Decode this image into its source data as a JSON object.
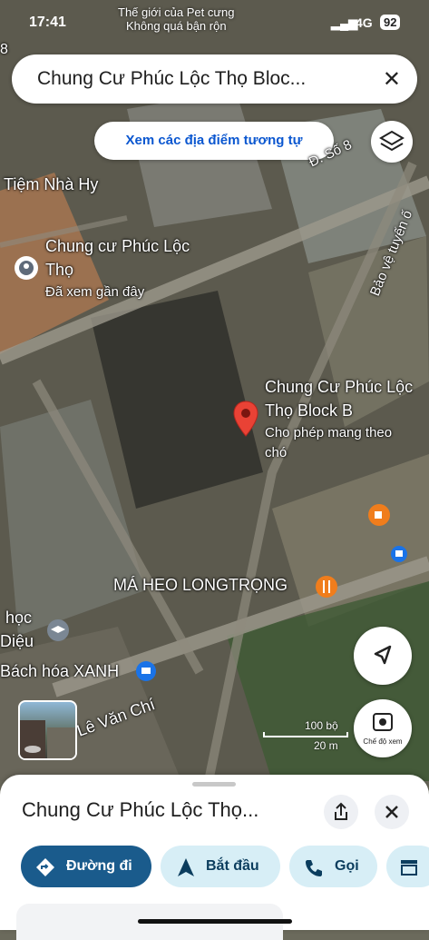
{
  "status": {
    "time": "17:41",
    "network": "4G",
    "battery": "92",
    "top_line1": "Thế giới của Pet cưng",
    "top_line2": "Không quá bận rộn"
  },
  "search": {
    "query": "Chung Cư Phúc Lộc Thọ Bloc...",
    "close_icon": "close-icon"
  },
  "similar_button": "Xem các địa điểm tương tự",
  "map_labels": {
    "tiem": "Tiệm Nhà Hy",
    "chungcu_line1": "Chung cư Phúc Lộc",
    "chungcu_line2": "Thọ",
    "chungcu_sub": "Đã xem gần đây",
    "block_line1": "Chung Cư Phúc Lộc",
    "block_line2": "Thọ Block B",
    "block_sub1": "Cho phép mang theo",
    "block_sub2": "chó",
    "mheo": "MÁ HEO LONGTRỌNG",
    "hoc": "học",
    "dieu": "Diệu",
    "bhx": "Bách hóa XANH",
    "levanchi": "Lê Văn Chí",
    "duongso8": "Đ. Số 8",
    "baove": "Bảo vệ tuyến ố",
    "num8": "8"
  },
  "scale": {
    "feet": "100 bộ",
    "meters": "20 m"
  },
  "street_view_caption": "Chế độ xem",
  "place": {
    "title": "Chung Cư Phúc Lộc Thọ...",
    "actions": [
      "Đường đi",
      "Bắt đầu",
      "Gọi"
    ]
  },
  "colors": {
    "accent": "#1a5b8c",
    "chip_bg": "#d7eef6",
    "pin_red": "#e94235"
  }
}
